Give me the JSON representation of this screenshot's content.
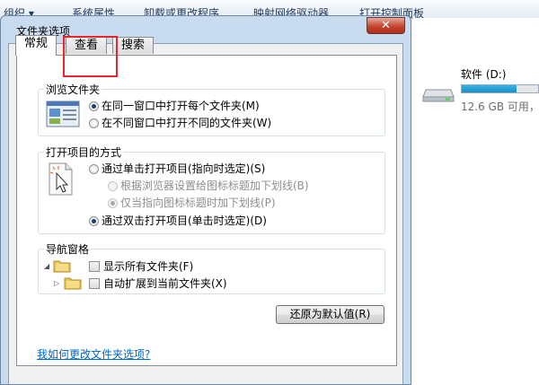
{
  "explorer": {
    "toolbar": {
      "items": [
        "组织 ▾",
        "系统属性",
        "卸载或更改程序",
        "映射网络驱动器",
        "打开控制面板"
      ]
    },
    "drive": {
      "name": "软件 (D:)",
      "free_text": "12.6 GB 可用，",
      "used_fraction": 0.72,
      "icon": "hard-drive-icon"
    }
  },
  "dialog": {
    "title": "文件夹选项",
    "close_label": "✕",
    "tabs": [
      {
        "label": "常规",
        "active": true
      },
      {
        "label": "查看",
        "active": false
      },
      {
        "label": "搜索",
        "active": false
      }
    ],
    "browse": {
      "label": "浏览文件夹",
      "icon": "browse-folders-icon",
      "options": [
        {
          "label": "在同一窗口中打开每个文件夹(M)",
          "selected": true
        },
        {
          "label": "在不同窗口中打开不同的文件夹(W)",
          "selected": false
        }
      ]
    },
    "click": {
      "label": "打开项目的方式",
      "icon": "click-pointer-icon",
      "single": {
        "label": "通过单击打开项目(指向时选定)(S)",
        "selected": false
      },
      "sub": [
        {
          "label": "根据浏览器设置给图标标题加下划线(B)",
          "selected": false
        },
        {
          "label": "仅当指向图标标题时加下划线(P)",
          "selected": true
        }
      ],
      "double": {
        "label": "通过双击打开项目(单击时选定)(D)",
        "selected": true
      }
    },
    "nav": {
      "label": "导航窗格",
      "options": [
        {
          "label": "显示所有文件夹(F)",
          "checked": false
        },
        {
          "label": "自动扩展到当前文件夹(X)",
          "checked": false
        }
      ]
    },
    "restore_label": "还原为默认值(R)",
    "help_link": "我如何更改文件夹选项?"
  },
  "colors": {
    "highlight": "#e8262c",
    "link": "#0066cc",
    "drive_fill": "#1c8fc4"
  }
}
